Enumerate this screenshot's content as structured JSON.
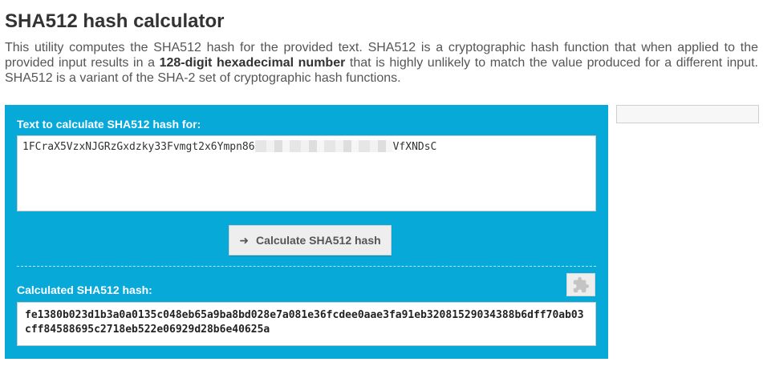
{
  "page": {
    "title": "SHA512 hash calculator",
    "intro": {
      "text_before": "This utility computes the SHA512 hash for the provided text. SHA512 is a cryptographic hash function that when applied to the provided input results in a ",
      "emphasis": "128-digit hexadecimal number",
      "text_after": " that is highly unlikely to match the value produced for a different input. SHA512 is a variant of the SHA-2 set of cryptographic hash functions."
    }
  },
  "tool": {
    "input_label": "Text to calculate SHA512 hash for:",
    "input_value_start": "1FCraX5VzxNJGRzGxdzky33Fvmgt2x6Ympn86",
    "input_value_end": "VfXNDsC",
    "calculate_button_label": "Calculate SHA512 hash",
    "output_label": "Calculated SHA512 hash:",
    "output_value": "fe1380b023d1b3a0a0135c048eb65a9ba8bd028e7a081e36fcdee0aae3fa91eb32081529034388b6dff70ab03cff84588695c2718eb522e06929d28b6e40625a"
  },
  "icons": {
    "button_icon": "arrow-right-icon",
    "extension_icon": "puzzle-icon"
  },
  "colors": {
    "panel_background": "#07a9d9",
    "label_text": "#ffffff",
    "title_text": "#333333",
    "button_background": "#eeeeee"
  }
}
